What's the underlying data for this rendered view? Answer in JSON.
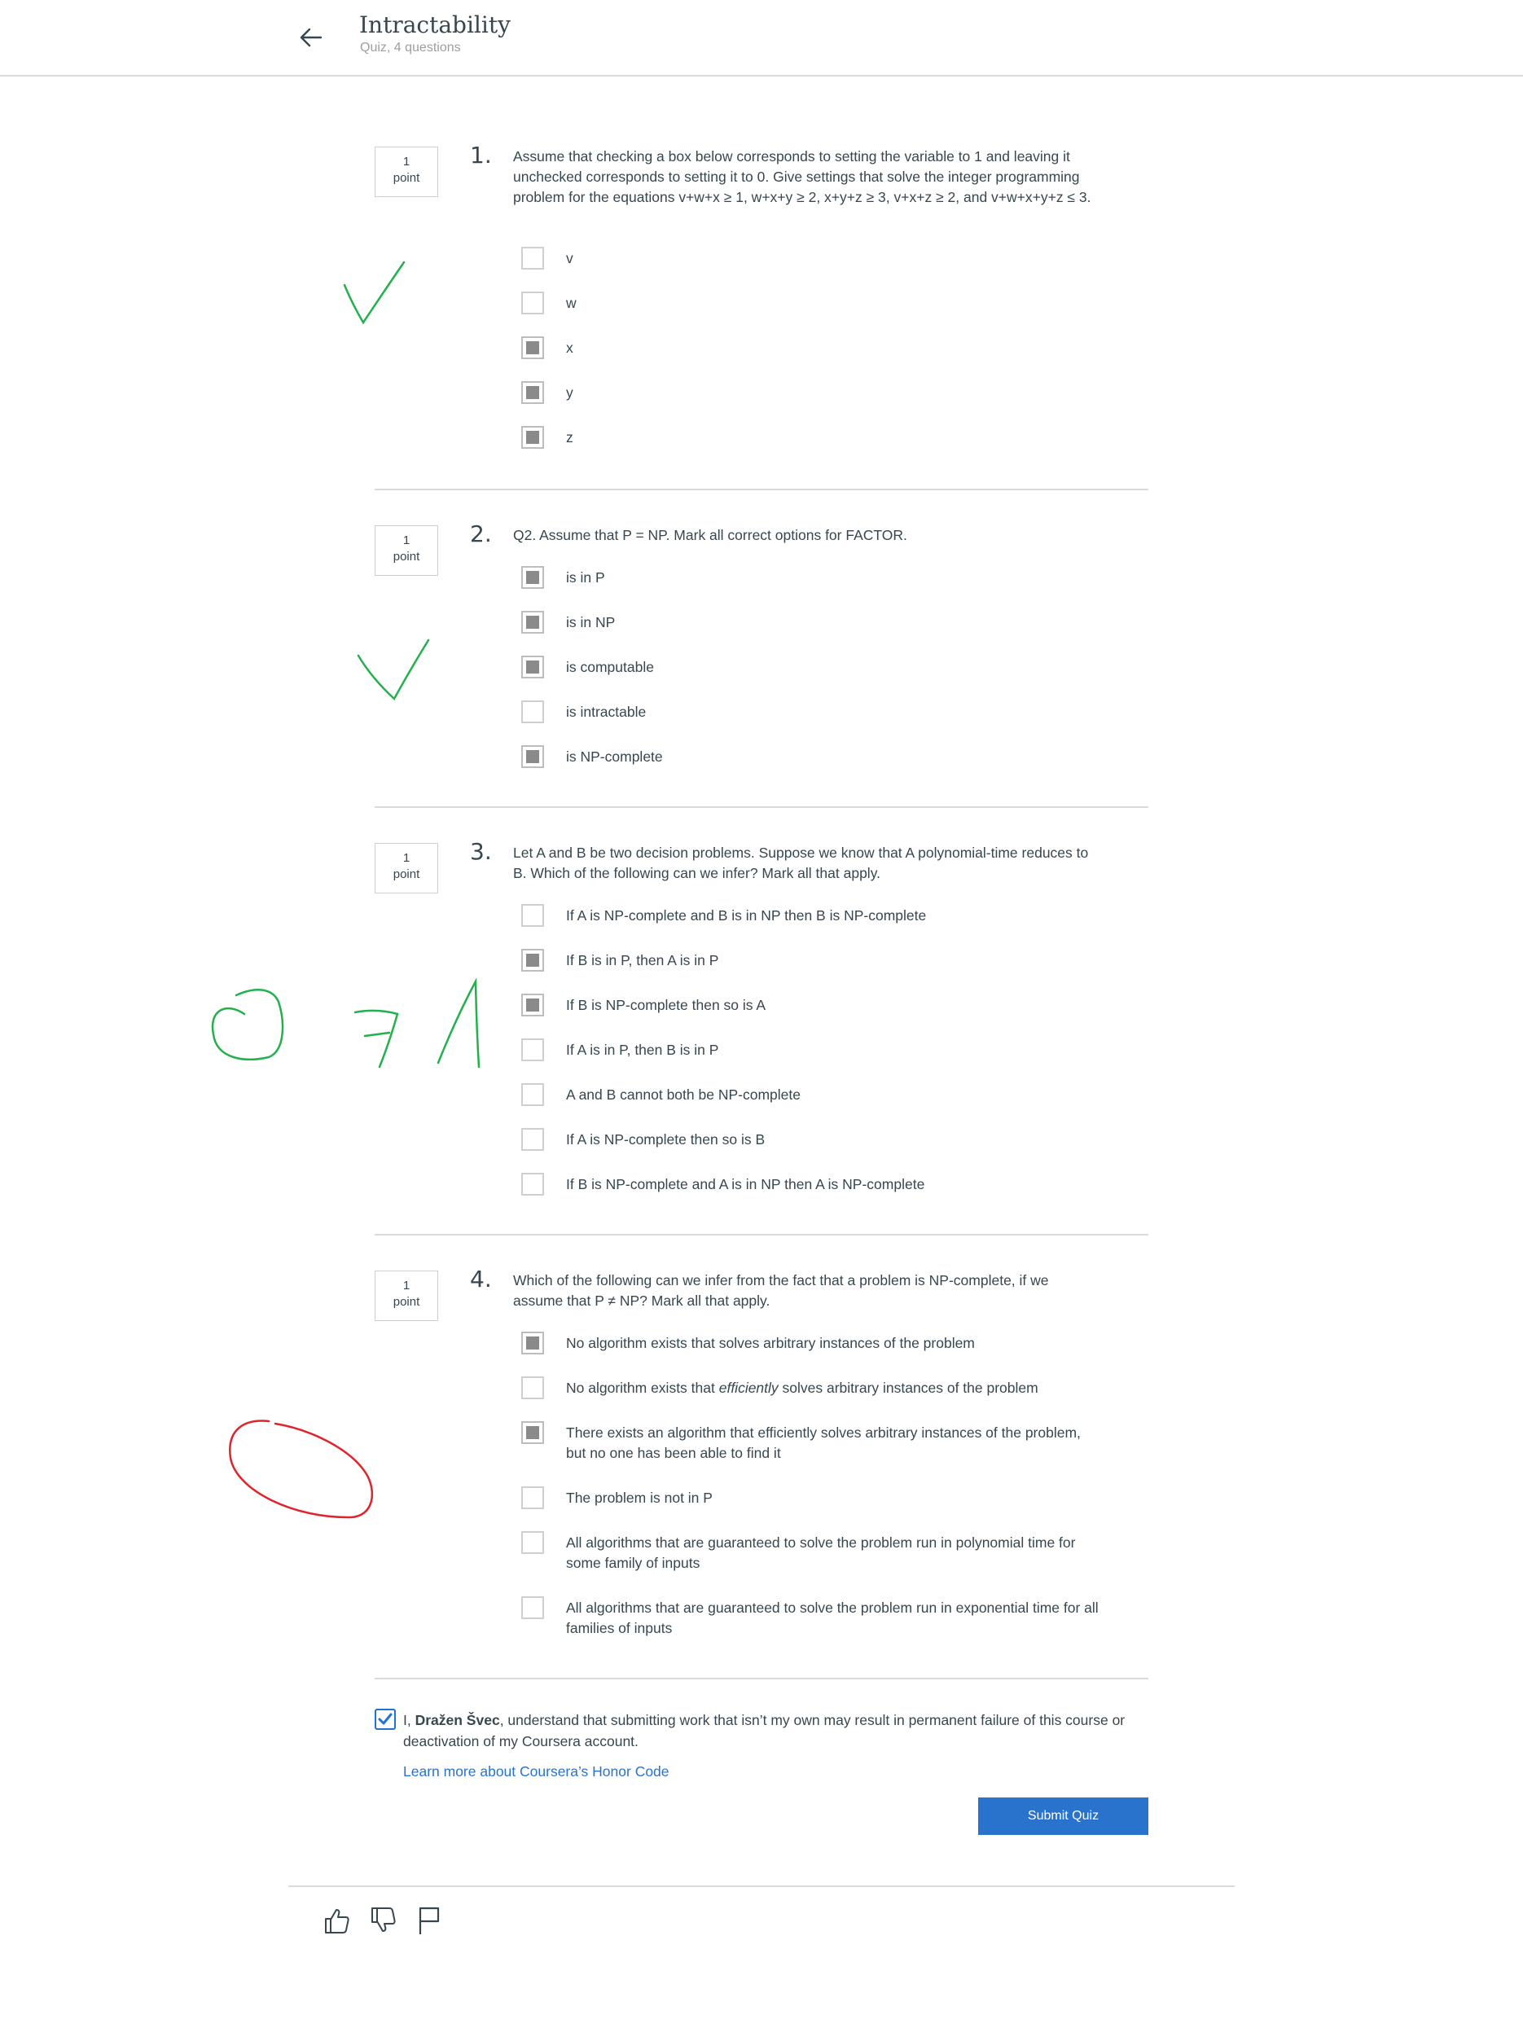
{
  "header": {
    "title": "Intractability",
    "subtitle": "Quiz, 4 questions"
  },
  "questions": [
    {
      "points_num": "1",
      "points_label": "point",
      "number": "1.",
      "text": "Assume that checking a box below corresponds to setting the variable to 1 and leaving it unchecked corresponds to setting it to 0. Give settings that solve the integer programming problem for the equations v+w+x ≥ 1, w+x+y ≥ 2, x+y+z ≥ 3, v+x+z ≥ 2, and v+w+x+y+z ≤ 3.",
      "options": [
        {
          "label": "v",
          "checked": false
        },
        {
          "label": "w",
          "checked": false
        },
        {
          "label": "x",
          "checked": true
        },
        {
          "label": "y",
          "checked": true
        },
        {
          "label": "z",
          "checked": true
        }
      ]
    },
    {
      "points_num": "1",
      "points_label": "point",
      "number": "2.",
      "text": "Q2. Assume that P = NP. Mark all correct options for FACTOR.",
      "options": [
        {
          "label": "is in P",
          "checked": true
        },
        {
          "label": "is in NP",
          "checked": true
        },
        {
          "label": "is computable",
          "checked": true
        },
        {
          "label": "is intractable",
          "checked": false
        },
        {
          "label": "is NP-complete",
          "checked": true
        }
      ]
    },
    {
      "points_num": "1",
      "points_label": "point",
      "number": "3.",
      "text": "Let A and B be two decision problems. Suppose we know that A polynomial-time reduces to B. Which of the following can we infer? Mark all that apply.",
      "options": [
        {
          "label": "If A is NP-complete and B is in NP then B is NP-complete",
          "checked": false
        },
        {
          "label": "If B is in P, then A is in P",
          "checked": true
        },
        {
          "label": "If B is NP-complete then so is A",
          "checked": true
        },
        {
          "label": "If A is in P, then B is in P",
          "checked": false
        },
        {
          "label": "A and B cannot both be NP-complete",
          "checked": false
        },
        {
          "label": "If A is NP-complete then so is B",
          "checked": false
        },
        {
          "label": "If B is NP-complete and A is in NP then A is NP-complete",
          "checked": false
        }
      ]
    },
    {
      "points_num": "1",
      "points_label": "point",
      "number": "4.",
      "text": "Which of the following can we infer from the fact that a problem is NP-complete, if we assume that P ≠ NP? Mark all that apply.",
      "options": [
        {
          "label": "No algorithm exists that solves arbitrary instances of the problem",
          "checked": true
        },
        {
          "label_pre": "No algorithm exists that ",
          "label_em": "efficiently",
          "label_post": " solves arbitrary instances of the problem",
          "checked": false
        },
        {
          "label": "There exists an algorithm that efficiently solves arbitrary instances of the problem, but no one has been able to find it",
          "checked": true
        },
        {
          "label": "The problem is not in P",
          "checked": false
        },
        {
          "label": "All algorithms that are guaranteed to solve the problem run in polynomial time for some family of inputs",
          "checked": false
        },
        {
          "label": "All algorithms that are guaranteed to solve the problem run in exponential time for all families of inputs",
          "checked": false
        }
      ]
    }
  ],
  "honor": {
    "checked": true,
    "text_pre": "I, ",
    "name": "Dražen Švec",
    "text_post": ", understand that submitting work that isn’t my own may result in permanent failure of this course or deactivation of my Coursera account.",
    "link": "Learn more about Coursera’s Honor Code"
  },
  "submit_label": "Submit Quiz",
  "footer_icons": [
    "thumbs-up-icon",
    "thumbs-down-icon",
    "flag-icon"
  ],
  "colors": {
    "accent": "#2a73cc",
    "checked_fill": "#8a8a8a",
    "annotation_green": "#22b14c",
    "annotation_red": "#e0242c"
  }
}
